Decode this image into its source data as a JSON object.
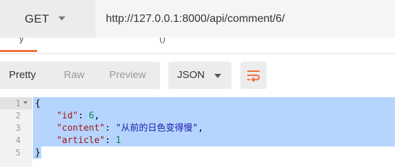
{
  "request": {
    "method": "GET",
    "url": "http://127.0.0.1:8000/api/comment/6/"
  },
  "view_modes": [
    "Pretty",
    "Raw",
    "Preview"
  ],
  "format": "JSON",
  "icons": {
    "method_caret": "chevron-down-icon",
    "format_caret": "chevron-down-icon",
    "wrap": "wrap-lines-icon",
    "fold": "fold-arrow-icon"
  },
  "colors": {
    "accent": "#f26b3a",
    "selection": "#b5d5ff"
  },
  "editor": {
    "line_numbers": [
      "1",
      "2",
      "3",
      "4",
      "5"
    ],
    "lines": [
      [
        "{"
      ],
      [
        "    ",
        "\"id\"",
        ": ",
        "6",
        ","
      ],
      [
        "    ",
        "\"content\"",
        ": ",
        "\"",
        "从前的日色变得慢",
        "\"",
        ","
      ],
      [
        "    ",
        "\"article\"",
        ": ",
        "1"
      ],
      [
        "}"
      ]
    ]
  }
}
